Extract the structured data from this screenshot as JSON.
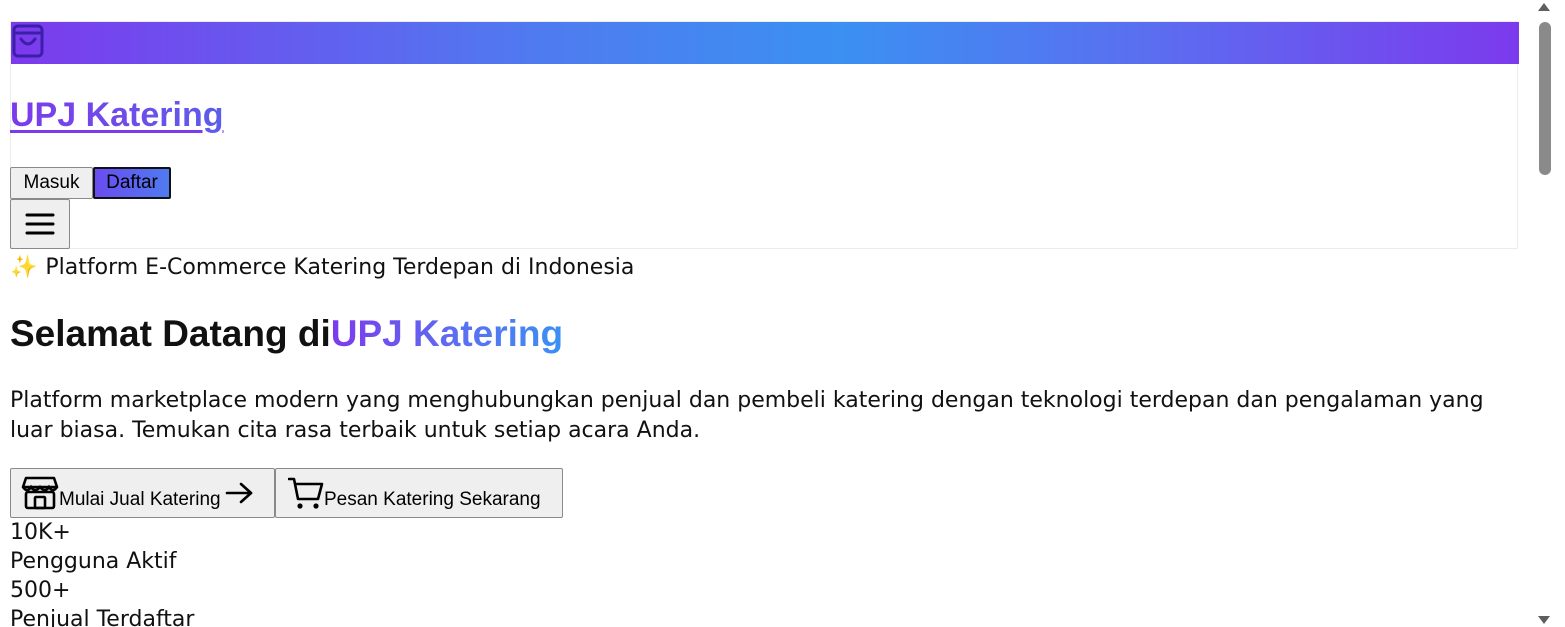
{
  "header": {
    "bag_icon": "shopping-bag-icon",
    "brand": "UPJ Katering",
    "login_label": "Masuk",
    "register_label": "Daftar",
    "menu_icon": "hamburger-menu-icon"
  },
  "hero": {
    "tagline_icon": "✨",
    "tagline": "Platform E-Commerce Katering Terdepan di Indonesia",
    "title_prefix": "Selamat Datang di",
    "title_highlight": "UPJ Katering",
    "description": "Platform marketplace modern yang menghubungkan penjual dan pembeli katering dengan teknologi terdepan dan pengalaman yang luar biasa. Temukan cita rasa terbaik untuk setiap acara Anda.",
    "cta_sell": "Mulai Jual Katering",
    "cta_order": "Pesan Katering Sekarang"
  },
  "stats": [
    {
      "value": "10K+",
      "label": "Pengguna Aktif"
    },
    {
      "value": "500+",
      "label": "Penjual Terdaftar"
    }
  ],
  "colors": {
    "brand_purple": "#7c3aed",
    "brand_blue": "#3b90f2"
  }
}
